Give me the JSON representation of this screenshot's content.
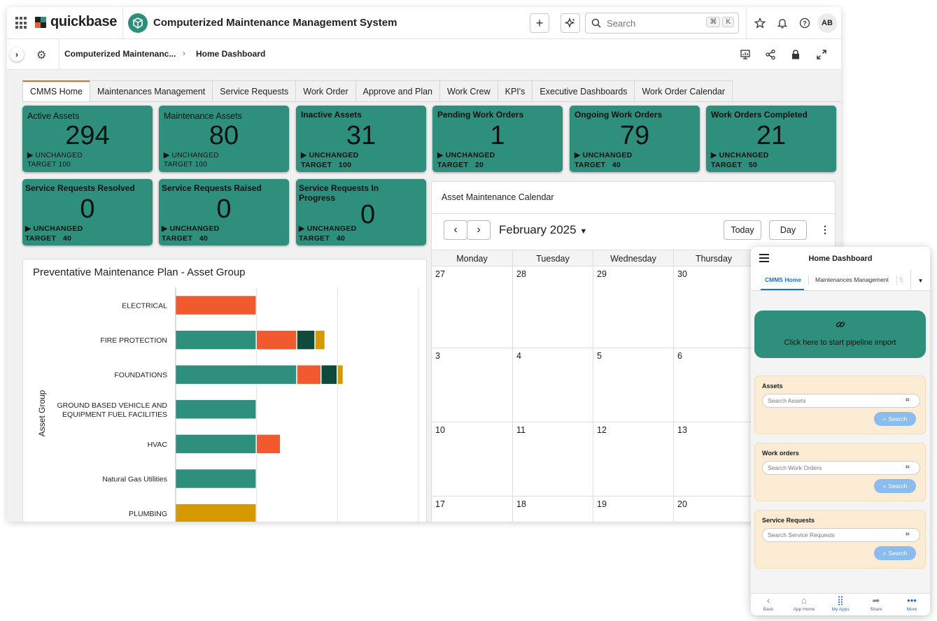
{
  "app": {
    "brand": "quickbase",
    "title": "Computerized Maintenance Management System",
    "search_placeholder": "Search",
    "search_shortcut": [
      "⌘",
      "K"
    ],
    "avatar_initials": "AB"
  },
  "breadcrumb": {
    "app": "Computerized Maintenanc...",
    "page": "Home Dashboard"
  },
  "tabs": [
    "CMMS Home",
    "Maintenances Management",
    "Service Requests",
    "Work Order",
    "Approve and Plan",
    "Work Crew",
    "KPI's",
    "Executive Dashboards",
    "Work Order Calendar"
  ],
  "kpis": [
    {
      "title": "Active Assets",
      "value": "294",
      "status": "UNCHANGED",
      "target": "TARGET 100"
    },
    {
      "title": "Maintenance Assets",
      "value": "80",
      "status": "UNCHANGED",
      "target": "TARGET 100"
    },
    {
      "title": "Inactive Assets",
      "value": "31",
      "status": "UNCHANGED",
      "target": "TARGET   100"
    },
    {
      "title": "Pending Work Orders",
      "value": "1",
      "status": "UNCHANGED",
      "target": "TARGET   20"
    },
    {
      "title": "Ongoing Work Orders",
      "value": "79",
      "status": "UNCHANGED",
      "target": "TARGET   40"
    },
    {
      "title": "Work Orders Completed",
      "value": "21",
      "status": "UNCHANGED",
      "target": "TARGET   50"
    },
    {
      "title": "Service Requests Resolved",
      "value": "0",
      "status": "UNCHANGED",
      "target": "TARGET   40"
    },
    {
      "title": "Service Requests Raised",
      "value": "0",
      "status": "UNCHANGED",
      "target": "TARGET   40"
    },
    {
      "title": "Service Requests In Progress",
      "value": "0",
      "status": "UNCHANGED",
      "target": "TARGET   40"
    }
  ],
  "chart_data": {
    "type": "bar",
    "orientation": "horizontal",
    "stacked": true,
    "title": "Preventative Maintenance Plan - Asset Group",
    "ylabel": "Asset Group",
    "categories": [
      "ELECTRICAL",
      "FIRE PROTECTION",
      "FOUNDATIONS",
      "GROUND BASED VEHICLE AND EQUIPMENT FUEL FACILITIES",
      "HVAC",
      "Natural Gas Utilities",
      "PLUMBING"
    ],
    "category_lines": [
      [
        "ELECTRICAL"
      ],
      [
        "FIRE PROTECTION"
      ],
      [
        "FOUNDATIONS"
      ],
      [
        "GROUND BASED VEHICLE AND",
        "EQUIPMENT FUEL FACILITIES"
      ],
      [
        "HVAC"
      ],
      [
        "Natural Gas Utilities"
      ],
      [
        "PLUMBING"
      ]
    ],
    "series": [
      {
        "color": "#2e8f7d",
        "values": [
          0,
          2,
          3,
          2,
          2,
          2,
          0
        ]
      },
      {
        "color": "#f05a2e",
        "values": [
          2,
          1,
          0.6,
          0,
          0.6,
          0,
          0
        ]
      },
      {
        "color": "#0f4a3c",
        "values": [
          0,
          0.45,
          0.4,
          0,
          0,
          0,
          0
        ]
      },
      {
        "color": "#d69a00",
        "values": [
          0,
          0.25,
          0.15,
          0,
          0,
          0,
          2
        ]
      }
    ],
    "xlim": [
      0,
      6
    ],
    "grid": true,
    "legend": "none"
  },
  "calendar": {
    "title": "Asset Maintenance Calendar",
    "month": "February 2025",
    "today_label": "Today",
    "view_label": "Day",
    "days": [
      "Monday",
      "Tuesday",
      "Wednesday",
      "Thursday"
    ],
    "weeks": [
      [
        "27",
        "28",
        "29",
        "30"
      ],
      [
        "3",
        "4",
        "5",
        "6"
      ],
      [
        "10",
        "11",
        "12",
        "13"
      ],
      [
        "17",
        "18",
        "19",
        "20"
      ]
    ]
  },
  "mobile": {
    "title": "Home Dashboard",
    "tabs": [
      "CMMS Home",
      "Maintenances Management",
      "S"
    ],
    "cta": "Click here to start pipeline import",
    "sections": [
      {
        "title": "Assets",
        "placeholder": "Search Assets",
        "button": "Search"
      },
      {
        "title": "Work orders",
        "placeholder": "Search Work Orders",
        "button": "Search"
      },
      {
        "title": "Service Requests",
        "placeholder": "Search Service Requests",
        "button": "Search"
      }
    ],
    "footer": [
      "Back",
      "App Home",
      "My Apps",
      "Share",
      "More"
    ]
  },
  "colors": {
    "accent": "#2e8f7d",
    "tab_active": "#e8622f",
    "mobile_link": "#1a6fd8"
  }
}
